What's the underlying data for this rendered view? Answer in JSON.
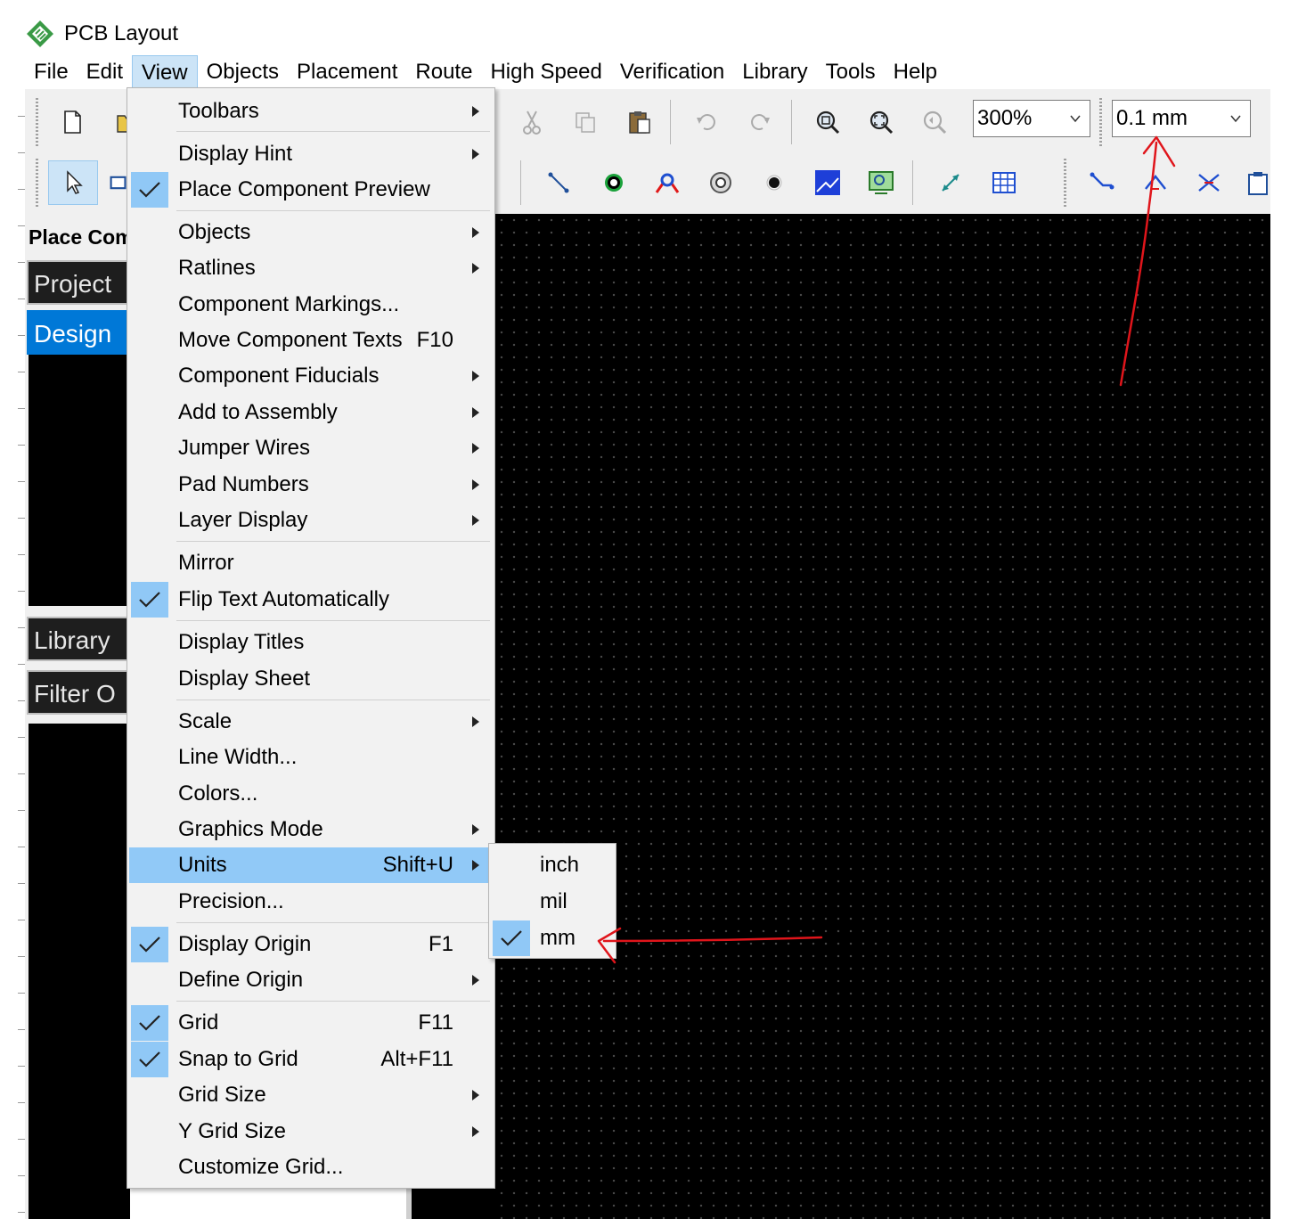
{
  "app": {
    "title": "PCB Layout"
  },
  "menubar": [
    "File",
    "Edit",
    "View",
    "Objects",
    "Placement",
    "Route",
    "High Speed",
    "Verification",
    "Library",
    "Tools",
    "Help"
  ],
  "toolbar": {
    "zoom_value": "300%",
    "grid_value": "0.1 mm"
  },
  "left_panel": {
    "header": "Place Com",
    "sections": [
      "Project",
      "Design",
      "Library",
      "Filter O"
    ]
  },
  "view_menu": {
    "items": {
      "toolbars": "Toolbars",
      "display_hint": "Display Hint",
      "place_component_preview": "Place Component Preview",
      "objects": "Objects",
      "ratlines": "Ratlines",
      "component_markings": "Component Markings...",
      "move_component_texts": "Move Component Texts",
      "move_component_texts_sc": "F10",
      "component_fiducials": "Component Fiducials",
      "add_to_assembly": "Add to Assembly",
      "jumper_wires": "Jumper Wires",
      "pad_numbers": "Pad Numbers",
      "layer_display": "Layer Display",
      "mirror": "Mirror",
      "flip_text": "Flip Text Automatically",
      "display_titles": "Display Titles",
      "display_sheet": "Display Sheet",
      "scale": "Scale",
      "line_width": "Line Width...",
      "colors": "Colors...",
      "graphics_mode": "Graphics Mode",
      "units": "Units",
      "units_sc": "Shift+U",
      "precision": "Precision...",
      "display_origin": "Display Origin",
      "display_origin_sc": "F1",
      "define_origin": "Define Origin",
      "grid": "Grid",
      "grid_sc": "F11",
      "snap_to_grid": "Snap to Grid",
      "snap_to_grid_sc": "Alt+F11",
      "grid_size": "Grid Size",
      "y_grid_size": "Y Grid Size",
      "customize_grid": "Customize Grid..."
    }
  },
  "units_submenu": {
    "inch": "inch",
    "mil": "mil",
    "mm": "mm",
    "checked": "mm"
  },
  "colors": {
    "highlight": "#91c9f7",
    "annotation": "#e0151b",
    "canvas": "#000000"
  }
}
